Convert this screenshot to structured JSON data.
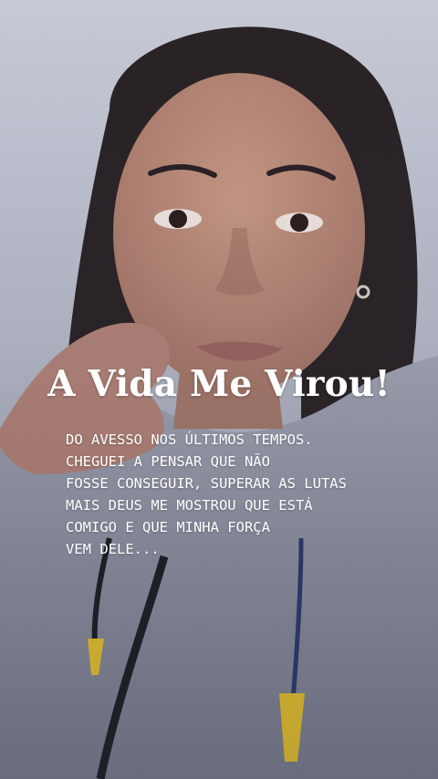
{
  "story": {
    "headline": "A Vida Me Virou!",
    "lines": [
      "DO AVESSO NOS ÚLTIMOS TEMPOS.",
      "CHEGUEI A PENSAR QUE NÃO",
      "FOSSE CONSEGUIR, SUPERAR AS LUTAS",
      "MAIS DEUS ME MOSTROU QUE ESTÁ",
      "COMIGO E QUE MINHA FORÇA",
      "VEM DELE..."
    ]
  },
  "colors": {
    "text": "#ffffff",
    "background": "#c7cad6",
    "hair": "#2a2326",
    "hoodie": "#8a8fa0",
    "aglet": "#f2cc2e"
  }
}
